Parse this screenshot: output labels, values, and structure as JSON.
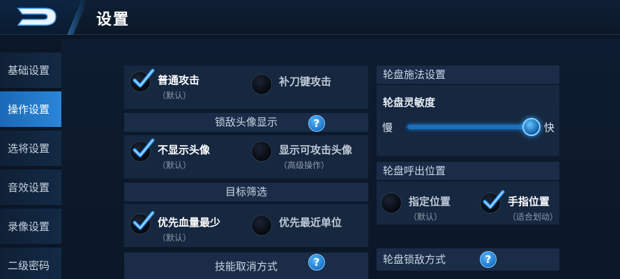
{
  "header": {
    "title": "设置"
  },
  "sidebar": {
    "items": [
      {
        "label": "基础设置"
      },
      {
        "label": "操作设置"
      },
      {
        "label": "选将设置"
      },
      {
        "label": "音效设置"
      },
      {
        "label": "录像设置"
      },
      {
        "label": "二级密码"
      }
    ],
    "active_index": 1
  },
  "attack": {
    "opt1": {
      "label": "普通攻击",
      "sub": "（默认）",
      "checked": true
    },
    "opt2": {
      "label": "补刀键攻击",
      "checked": false
    }
  },
  "lock_avatar": {
    "title": "锁敌头像显示",
    "help": "?",
    "opt1": {
      "label": "不显示头像",
      "sub": "（默认）",
      "checked": true
    },
    "opt2": {
      "label": "显示可攻击头像",
      "sub": "（高级操作）",
      "checked": false
    }
  },
  "target": {
    "title": "目标筛选",
    "opt1": {
      "label": "优先血量最少",
      "sub": "（默认）",
      "checked": true
    },
    "opt2": {
      "label": "优先最近单位",
      "checked": false
    }
  },
  "cancel": {
    "title": "技能取消方式",
    "help": "?"
  },
  "wheel_cast": {
    "title": "轮盘施法设置",
    "sensitivity_label": "轮盘灵敏度",
    "slow": "慢",
    "fast": "快",
    "sensitivity_value": 1.0
  },
  "wheel_position": {
    "title": "轮盘呼出位置",
    "opt1": {
      "label": "指定位置",
      "sub": "（默认）",
      "checked": false
    },
    "opt2": {
      "label": "手指位置",
      "sub": "（适合划动）",
      "checked": true
    }
  },
  "wheel_lock": {
    "title": "轮盘锁敌方式",
    "help": "?"
  },
  "colors": {
    "accent": "#2a86d8",
    "check": "#2e9bff",
    "panel": "#162740"
  }
}
